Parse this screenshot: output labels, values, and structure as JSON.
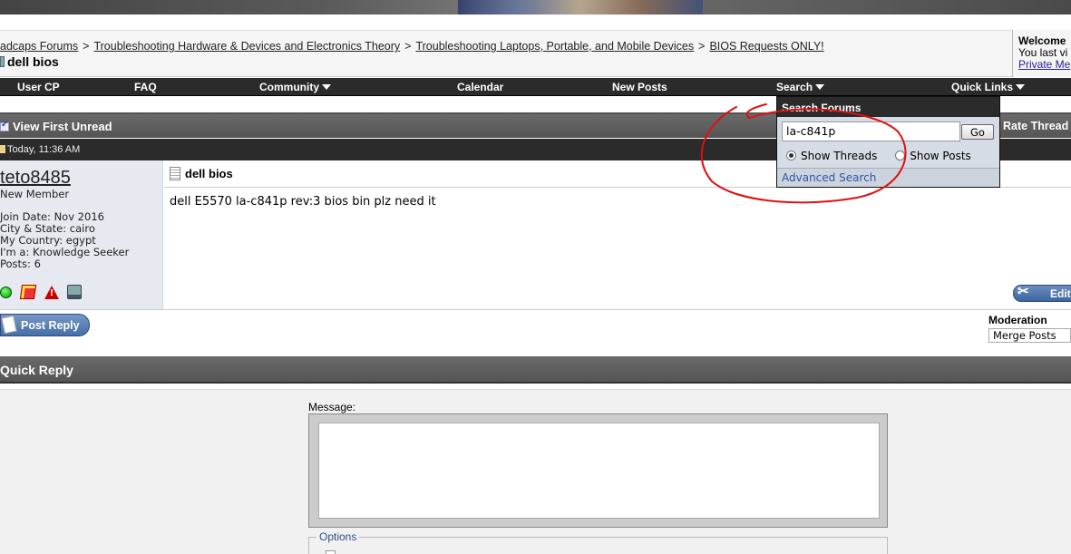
{
  "breadcrumb": {
    "items": [
      "adcaps Forums",
      "Troubleshooting Hardware & Devices and Electronics Theory",
      "Troubleshooting Laptops, Portable, and Mobile Devices",
      "BIOS Requests ONLY!"
    ],
    "separator": ">"
  },
  "thread": {
    "title": "dell bios"
  },
  "welcome": {
    "title": "Welcome",
    "last_visit": "You last vi",
    "private_messages": "Private Me"
  },
  "navbar": {
    "user_cp": "User CP",
    "faq": "FAQ",
    "community": "Community",
    "calendar": "Calendar",
    "new_posts": "New Posts",
    "search": "Search",
    "quick_links": "Quick Links"
  },
  "thread_tools": {
    "view_first_unread": "View First Unread",
    "rate_thread": "Rate Thread"
  },
  "post": {
    "date": "Today, 11:36 AM",
    "title": "dell bios",
    "message": "dell E5570 la-c841p rev:3 bios bin plz need it",
    "edit_label": "Edit"
  },
  "user": {
    "name": "teto8485",
    "rank": "New Member",
    "info": [
      "Join Date: Nov 2016",
      "City & State: cairo",
      "My Country: egypt",
      "I'm a: Knowledge Seeker",
      "Posts: 6"
    ],
    "icons": [
      "online-status-icon",
      "reputation-icon",
      "report-post-icon",
      "computer-icon"
    ]
  },
  "reply": {
    "post_reply_label": "Post Reply",
    "moderation_label": "Moderation",
    "moderation_selected": "Merge Posts"
  },
  "quick_reply": {
    "title": "Quick Reply",
    "message_label": "Message:",
    "options_label": "Options"
  },
  "search_popup": {
    "title": "Search Forums",
    "query": "la-c841p",
    "go_label": "Go",
    "option_threads": "Show Threads",
    "option_posts": "Show Posts",
    "selected_option": "Show Threads",
    "advanced_label": "Advanced Search"
  },
  "colors": {
    "nav_bg": "#2b2b2b",
    "link": "#2c57a5",
    "button_blue": "#456fa6",
    "annotation": "#e01010"
  }
}
